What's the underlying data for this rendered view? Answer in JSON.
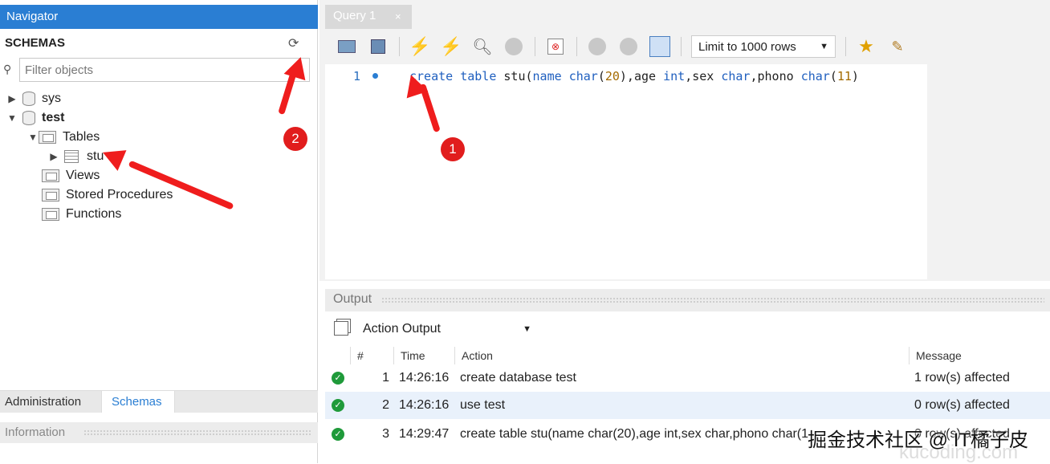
{
  "navigator": {
    "title": "Navigator",
    "schemas_label": "SCHEMAS",
    "filter_placeholder": "Filter objects",
    "tree": {
      "sys": "sys",
      "test": "test",
      "tables": "Tables",
      "stu": "stu",
      "views": "Views",
      "procedures": "Stored Procedures",
      "functions": "Functions"
    },
    "tabs": {
      "administration": "Administration",
      "schemas": "Schemas"
    },
    "information": "Information"
  },
  "query": {
    "tab_label": "Query 1",
    "tab_close": "×",
    "limit_label": "Limit to 1000 rows",
    "line_number": "1",
    "code": {
      "t1": "create",
      "t2": " ",
      "t3": "table",
      "t4": " stu(",
      "t5": "name",
      "t6": " ",
      "t7": "char",
      "t8": "(",
      "t9": "20",
      "t10": "),age ",
      "t11": "int",
      "t12": ",sex ",
      "t13": "char",
      "t14": ",phono ",
      "t15": "char",
      "t16": "(",
      "t17": "11",
      "t18": ")"
    }
  },
  "output": {
    "header": "Output",
    "select_value": "Action Output",
    "columns": [
      "#",
      "Time",
      "Action",
      "Message"
    ],
    "rows": [
      {
        "num": "1",
        "time": "14:26:16",
        "action": "create database test",
        "message": "1 row(s) affected"
      },
      {
        "num": "2",
        "time": "14:26:16",
        "action": "use test",
        "message": "0 row(s) affected"
      },
      {
        "num": "3",
        "time": "14:29:47",
        "action": "create table stu(name char(20),age int,sex char,phono char(1",
        "message": "0 row(s) affected"
      }
    ]
  },
  "annotations": {
    "badge1": "1",
    "badge2": "2"
  },
  "watermark": "掘金技术社区 @ IT橘子皮",
  "watermark2": "kucoding.com",
  "colors": {
    "accent": "#2a7ed3",
    "annotation_red": "#ef1d1d",
    "ok_green": "#1f9a3a"
  }
}
